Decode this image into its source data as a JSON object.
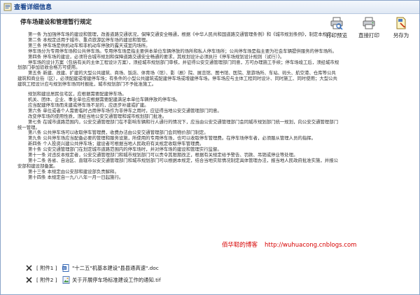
{
  "window": {
    "title": "查看详细信息"
  },
  "toolbar": {
    "print_preview": "打印预览",
    "direct_print": "直接打印",
    "save_as": "另存为"
  },
  "document": {
    "title": "停车场建设和管理暂行规定",
    "paragraphs": [
      {
        "indent": true,
        "text": "第一条 为加强停车场的建设和管理，改善道路交通状况，保障交通安全畅通，根据《中华人民共和国道路交通管理条例》和《城市规划条例》，制定本规定。"
      },
      {
        "indent": true,
        "text": "第二条 本规定适用于城市、重点旅游区停车场的建设和管理。"
      },
      {
        "indent": true,
        "text": "第三条 停车场是供机动车和非机动车停放的露天或室内场所。"
      },
      {
        "indent": true,
        "text": "停车场分为专用停车场和公共停车场。专用停车场是指主要供本单位车辆停放的场所和私人停车场所；公共停车场是指主要为社会车辆提供服务的停车场所。"
      },
      {
        "indent": true,
        "text": "第四条 停车场的建设，必须符合城市规划和保障道路交通安全畅通的要求，其规划设计必须执行《停车场规划设计规则（试行）》。"
      },
      {
        "indent": true,
        "text": "停车场的设计方案（包括有关的主体工程设计方案），须经城市规划部门审核，并征得公安交通管理部门同意，方可办理施工手续；停车场竣工后，须经城市规划部门参加验收合格方可使用。"
      },
      {
        "indent": true,
        "text": "第五条 新建、改建、扩建的大型公共建筑、商场、饭店、体育场（馆）、影（剧）院、展览馆、图书馆、医院、旅游场所、车站、码头、航空港、仓库等公共建筑和商业街（区），必须配建或增建停车场；有条件的小型公共建筑或配建停车场或增建停车场。停车场应与主体工程同时设计、同时施工、同时使用；大型公共建筑工程设计应与规划停车场同时报批，城市规划部门不予批准施工。"
      },
      {
        "indent": false,
        "text": ""
      },
      {
        "indent": true,
        "text": "规划和建设居民住宅区，应根据需要配建停车场。"
      },
      {
        "indent": true,
        "text": "机关、团体、企业、事业单位应根据需要配建满足本单位车辆停放的停车场。"
      },
      {
        "indent": true,
        "text": "应当配建停车场而未建或停车场不足的，应逐步补建或扩建。"
      },
      {
        "indent": true,
        "text": "第六条 单位或者个人需要临时占用停车场作为非停车之用时，应征得当地公安交通管理部门同意。"
      },
      {
        "indent": true,
        "text": "改变停车场的使用性质，须经当地公安交通管理和城市规划部门批准。"
      },
      {
        "indent": true,
        "text": "第七条 在城市道路范围内，公安交通管理部门在不影响车辆和行人通行的情况下，应当由公安交通管理部门会同城市规划部门统一规划，向公安交通管理部门统一管理。"
      },
      {
        "indent": true,
        "text": "第八条 公共停车场可以收取停车管理费，收费办法由公安交通管理部门会同物价部门制定。"
      },
      {
        "indent": true,
        "text": "第九条 公共停车场应当配备必要的管理和服务设施，所使用的专用停车场，也可以收取停车管理费。在停车场停车者，必须服从管理人员的指挥。"
      },
      {
        "indent": true,
        "text": "新四条 个人投资兴建公共停车场；建设者可根据当地人民政府有关规定收取停车管理费。"
      },
      {
        "indent": true,
        "text": "第十条 公安交通管理部门在划定城市道路范围内的停车场时，并对停车场的建设和管理实行监督。"
      },
      {
        "indent": true,
        "text": "第十一条 对违反本规定者，公安交通管理部门和城市规划部门可以责令其限期改正，根据有关规定给予警告、罚款、吊销或停业等处理。"
      },
      {
        "indent": true,
        "text": "第十二条 各省、自治区、直辖市公安交通管理部门和城市规划部门可以根据本规定，结合当地实际情况制定具体管理办法，报当地人民政府批准实施，并报公安部和建设部备案。"
      },
      {
        "indent": true,
        "text": "第十三条 本规定由公安部和建设部负责解释。"
      },
      {
        "indent": true,
        "text": "第十四条 本规定自一九八八年一月一日起施行。"
      }
    ]
  },
  "watermark": {
    "author": "佰华聪的博客",
    "url": "http://wuhuacong.cnblogs.com"
  },
  "attachments": [
    {
      "tag": "[ 附件1 ]",
      "name": "\"十二五\"机基本建设\"县县通高速\".doc",
      "icon": "word-doc-icon"
    },
    {
      "tag": "[ 附件2 ]",
      "name": "关于开展停车场标准建设工作的通知.tif",
      "icon": "image-file-icon"
    }
  ]
}
